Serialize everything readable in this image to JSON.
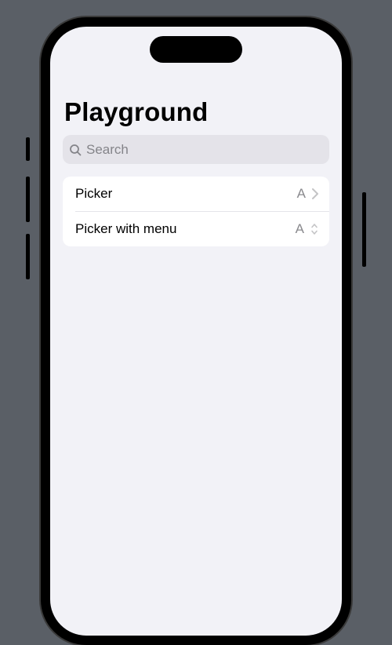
{
  "header": {
    "title": "Playground"
  },
  "search": {
    "placeholder": "Search"
  },
  "list": {
    "rows": [
      {
        "label": "Picker",
        "value": "A",
        "accessory": "chevron"
      },
      {
        "label": "Picker with menu",
        "value": "A",
        "accessory": "updown"
      }
    ]
  }
}
